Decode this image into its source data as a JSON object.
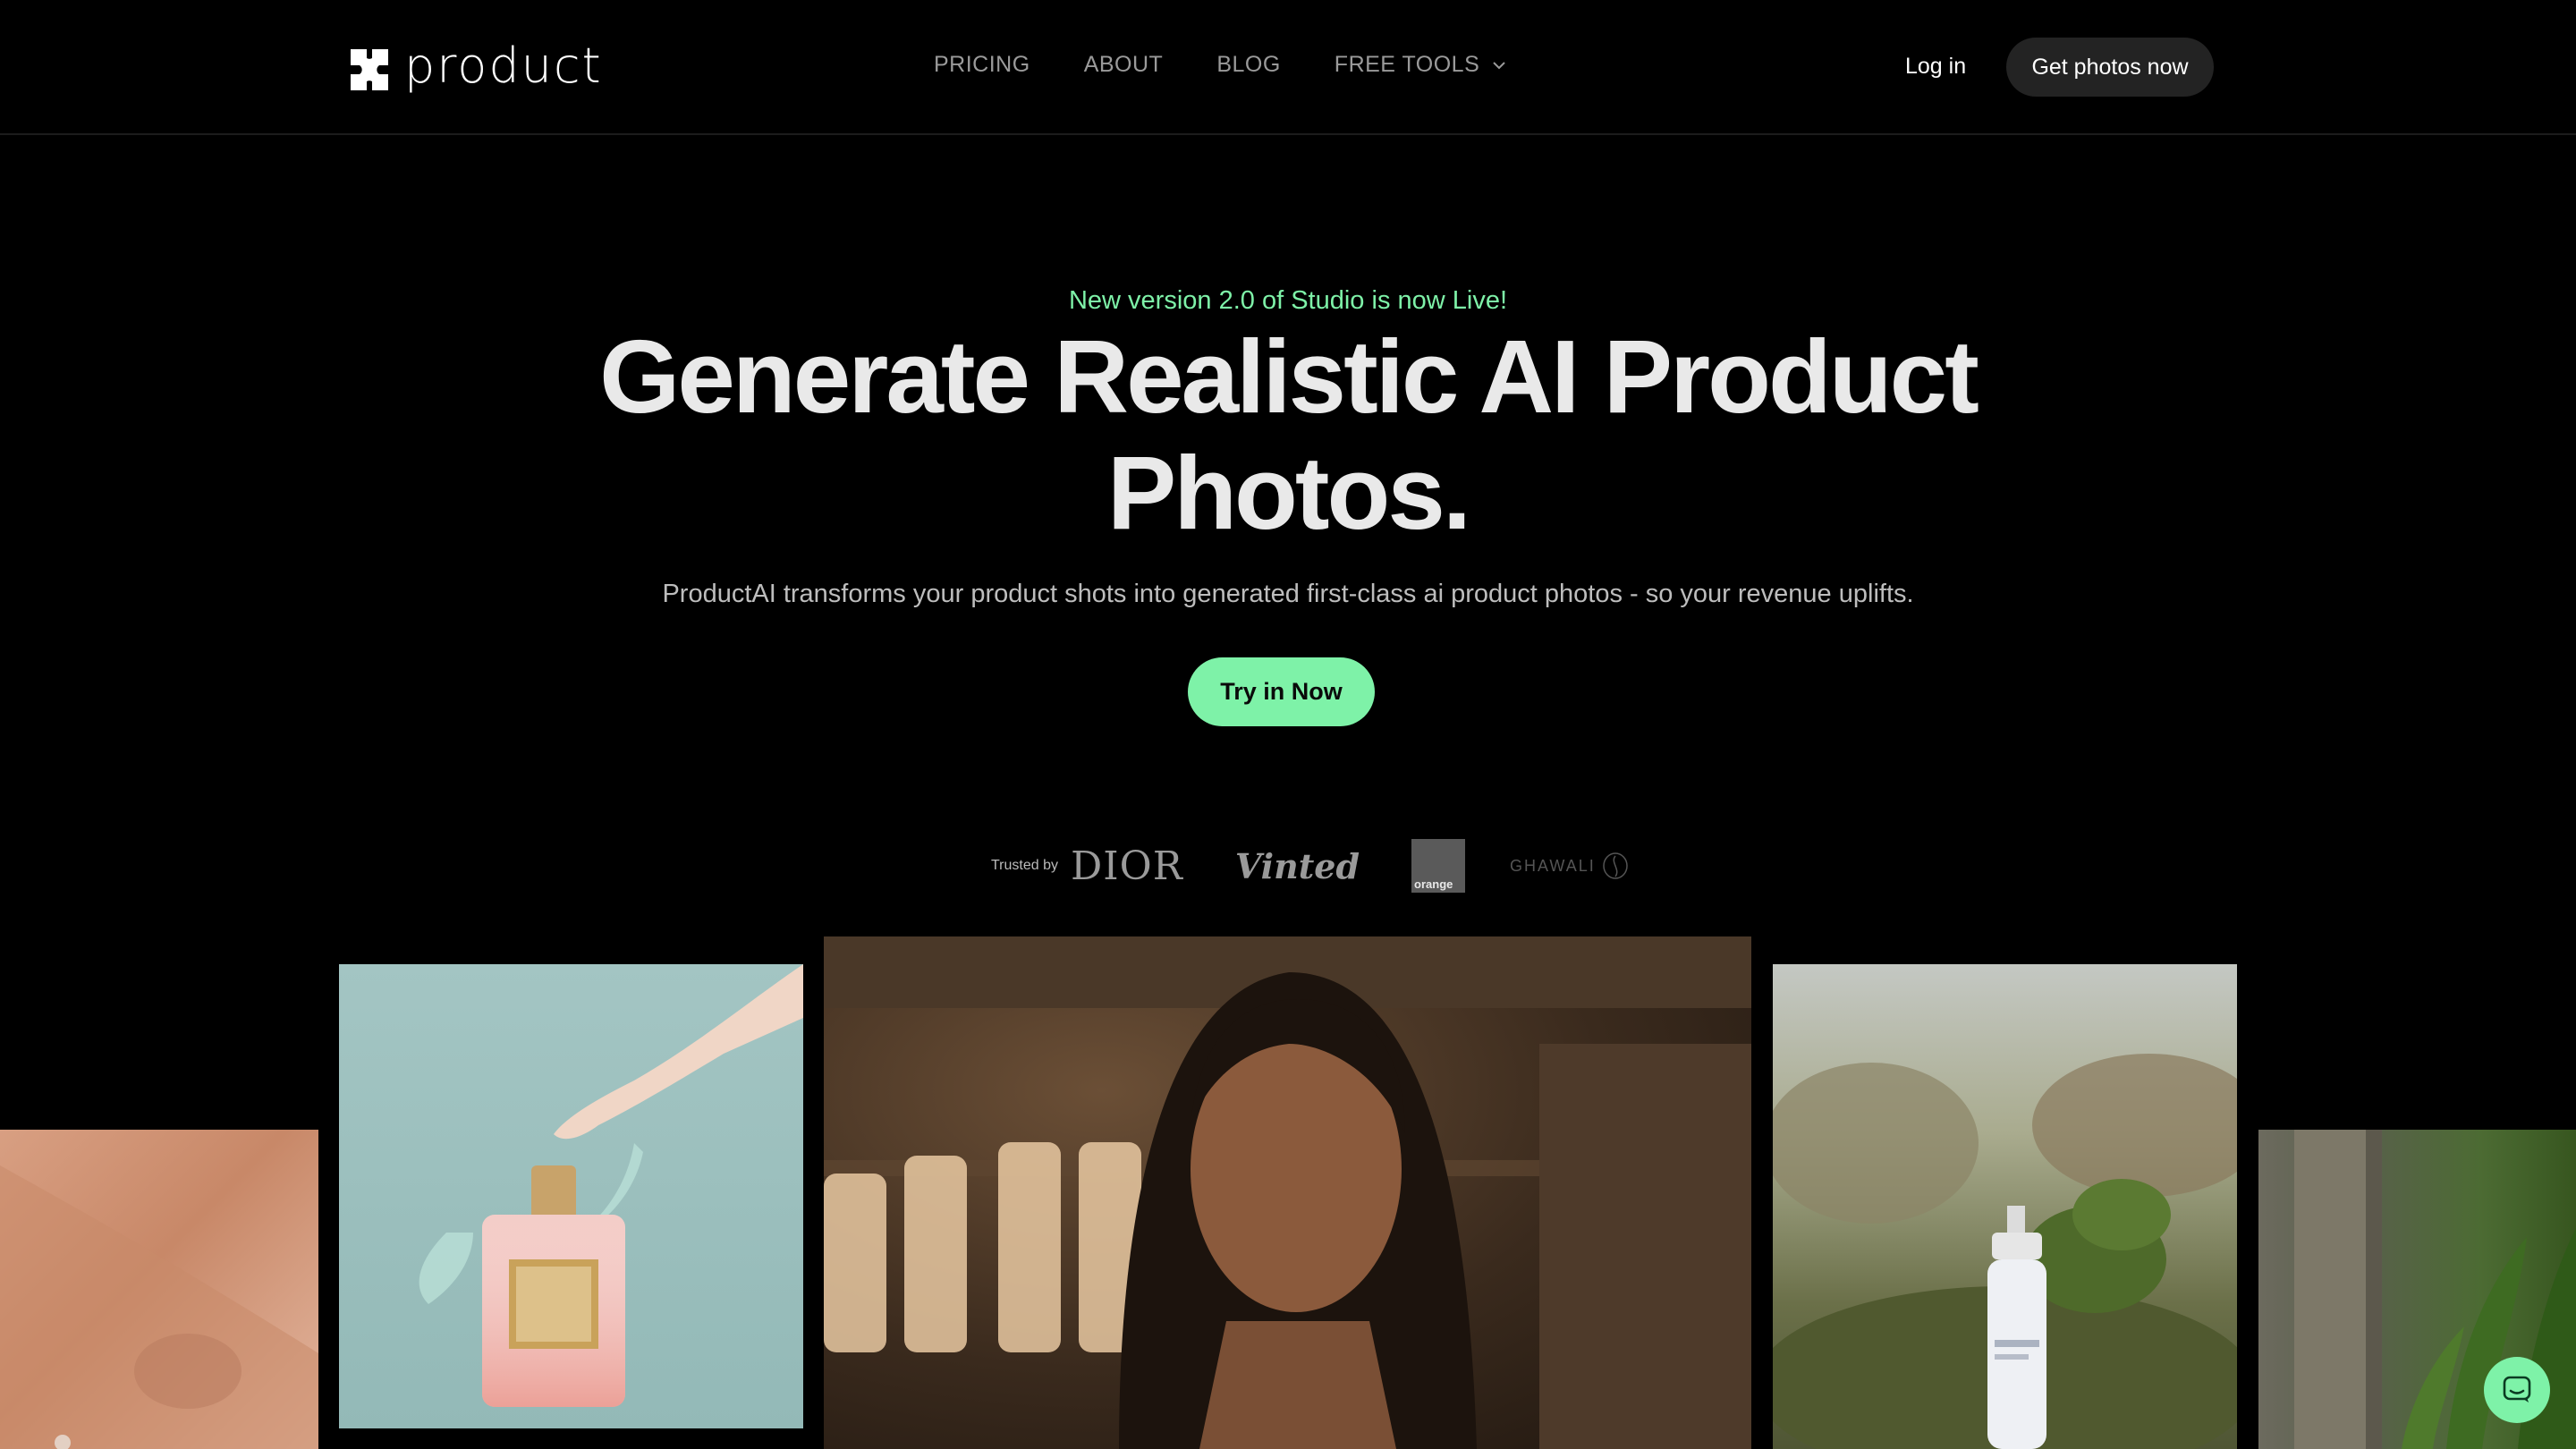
{
  "nav": {
    "brand": "product",
    "links": [
      {
        "label": "PRICING"
      },
      {
        "label": "ABOUT"
      },
      {
        "label": "BLOG"
      },
      {
        "label": "FREE TOOLS",
        "has_dropdown": true
      }
    ],
    "login_label": "Log in",
    "cta_label": "Get photos now"
  },
  "hero": {
    "badge": "New version 2.0 of Studio is now Live!",
    "headline_line1": "Generate Realistic AI Product",
    "headline_line2": "Photos.",
    "subtitle": "ProductAI transforms your product shots into generated first-class ai product photos - so your revenue uplifts.",
    "cta_label": "Try in Now"
  },
  "trusted": {
    "label": "Trusted by",
    "brands": [
      "DIOR",
      "Vinted",
      "orange",
      "GHAWALI"
    ]
  },
  "colors": {
    "accent": "#7ef2a8",
    "background": "#000000",
    "nav_button": "#232323"
  },
  "gallery": {
    "images": [
      "hand-ring-photo",
      "perfume-bottle-photo",
      "woman-portrait-photo",
      "serum-bottle-garden-photo",
      "garden-pillar-photo"
    ]
  },
  "chat_widget": {
    "icon": "chat-bubble-icon"
  }
}
